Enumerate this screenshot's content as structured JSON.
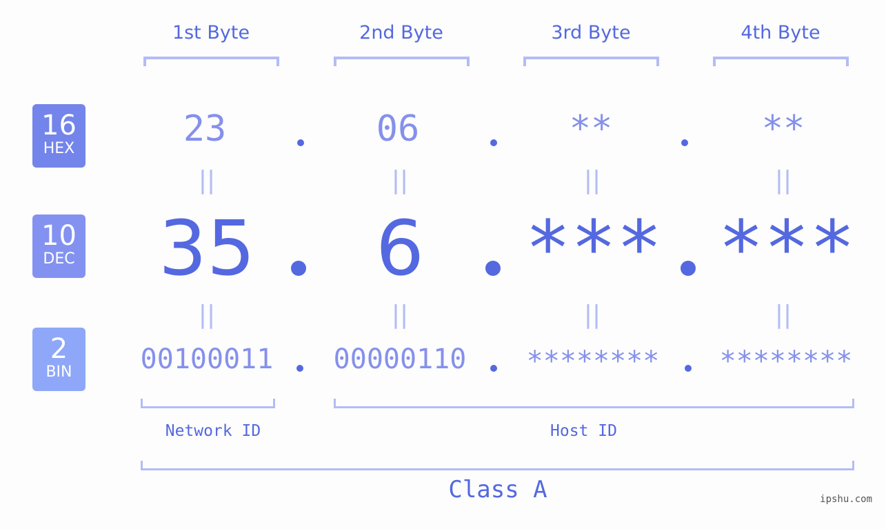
{
  "badges": [
    {
      "num": "16",
      "label": "HEX",
      "color": "#7384ea"
    },
    {
      "num": "10",
      "label": "DEC",
      "color": "#8392f0"
    },
    {
      "num": "2",
      "label": "BIN",
      "color": "#8ea7f8"
    }
  ],
  "bytes": [
    {
      "header": "1st Byte",
      "hex": "23",
      "dec": "35",
      "bin": "00100011"
    },
    {
      "header": "2nd Byte",
      "hex": "06",
      "dec": "6",
      "bin": "00000110"
    },
    {
      "header": "3rd Byte",
      "hex": "**",
      "dec": "***",
      "bin": "********"
    },
    {
      "header": "4th Byte",
      "hex": "**",
      "dec": "***",
      "bin": "********"
    }
  ],
  "equals_sign": "||",
  "labels": {
    "network_id": "Network ID",
    "host_id": "Host ID",
    "class": "Class A"
  },
  "watermark": "ipshu.com",
  "colors": {
    "primary": "#5468e0",
    "secondary": "#8590ec",
    "bracket": "#b3bcf5",
    "background": "#fcfdfc"
  }
}
